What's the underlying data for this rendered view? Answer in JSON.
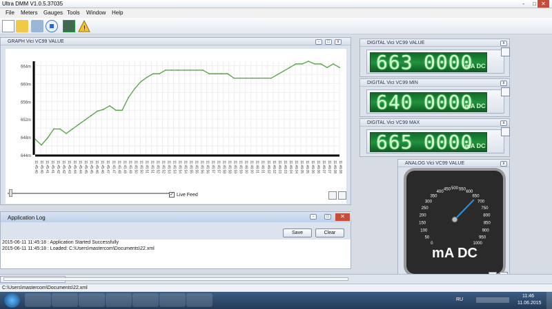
{
  "app": {
    "title": "Ultra DMM V1.0.5.37035",
    "window_controls": [
      "-",
      "□",
      "✕"
    ]
  },
  "menu": [
    "File",
    "Meters",
    "Gauges",
    "Tools",
    "Window",
    "Help"
  ],
  "toolbar": {
    "icons": [
      "new-file-icon",
      "open-folder-icon",
      "save-icon",
      "stop-icon",
      "monitor-icon",
      "warning-icon"
    ]
  },
  "graph_panel": {
    "title": "GRAPH Vici VC99 VALUE",
    "live_feed_label": "Live Feed",
    "live_feed_checked": true
  },
  "chart_data": {
    "type": "line",
    "title": "",
    "xlabel": "",
    "ylabel": "",
    "ylim": [
      644,
      665
    ],
    "y_ticks": [
      "664m",
      "660m",
      "656m",
      "652m",
      "648m",
      "644m"
    ],
    "x_ticks": [
      "11:45:40",
      "11:45:40",
      "11:45:41",
      "11:45:41",
      "11:45:42",
      "11:45:42",
      "11:45:43",
      "11:45:44",
      "11:45:44",
      "11:45:45",
      "11:45:45",
      "11:45:46",
      "11:45:46",
      "11:45:47",
      "11:45:47",
      "11:45:48",
      "11:45:49",
      "11:45:49",
      "11:45:50",
      "11:45:50",
      "11:45:51",
      "11:45:51",
      "11:45:52",
      "11:45:52",
      "11:45:53",
      "11:45:53",
      "11:45:54",
      "11:45:54",
      "11:45:55",
      "11:45:55",
      "11:45:56",
      "11:45:56",
      "11:45:57",
      "11:45:57",
      "11:45:58",
      "11:45:58",
      "11:45:59",
      "11:45:59",
      "11:46:00",
      "11:46:00",
      "11:46:01",
      "11:46:01",
      "11:46:02",
      "11:46:02",
      "11:46:03",
      "11:46:03",
      "11:46:04",
      "11:46:04",
      "11:46:05",
      "11:46:05",
      "11:46:06",
      "11:46:06",
      "11:46:07",
      "11:46:07",
      "11:46:08",
      "11:46:08"
    ],
    "series": [
      {
        "name": "",
        "color": "#5aa84a",
        "values": [
          647.5,
          646.2,
          647.8,
          649.8,
          649.8,
          648.8,
          649.8,
          650.8,
          651.8,
          652.8,
          653.8,
          654.2,
          655.0,
          654.0,
          654.0,
          656.8,
          658.8,
          660.4,
          661.4,
          662.2,
          662.2,
          663.0,
          663.0,
          663.0,
          663.0,
          663.0,
          663.0,
          663.0,
          662.2,
          662.2,
          662.2,
          662.2,
          661.2,
          661.2,
          661.2,
          661.2,
          661.2,
          661.2,
          661.2,
          662.0,
          662.8,
          663.6,
          664.4,
          664.4,
          665.0,
          664.4,
          664.4,
          663.6,
          664.4,
          663.6
        ]
      }
    ],
    "grid": true
  },
  "digital_value": {
    "title": "DIGITAL Vici VC99 VALUE",
    "main": "663",
    "decimal": "0000",
    "unit": "mA DC"
  },
  "digital_min": {
    "title": "DIGITAL Vici VC99 MIN",
    "main": "640",
    "decimal": "0000",
    "unit": "mA DC"
  },
  "digital_max": {
    "title": "DIGITAL Vici VC99 MAX",
    "main": "665",
    "decimal": "0000",
    "unit": "mA DC"
  },
  "analog": {
    "title": "ANALOG Vici VC99 VALUE",
    "labels": [
      "0",
      "50",
      "100",
      "150",
      "200",
      "250",
      "300",
      "350",
      "400",
      "450",
      "500",
      "550",
      "600",
      "650",
      "700",
      "750",
      "800",
      "850",
      "900",
      "950",
      "1000"
    ],
    "value": 663,
    "unit": "mA DC"
  },
  "log_panel": {
    "title": "Application Log",
    "save_label": "Save",
    "clear_label": "Clear",
    "lines": [
      "2015-06-11 11:45:18 : Application Started Successfully",
      "2015-06-11 11:45:18 : Loaded: C:\\Users\\mastercom\\Documents\\22.xml"
    ]
  },
  "status": {
    "path": "C:\\Users\\mastercom\\Documents\\22.xml"
  },
  "taskbar": {
    "lang": "RU",
    "time": "11:46",
    "date": "11.06.2015"
  }
}
